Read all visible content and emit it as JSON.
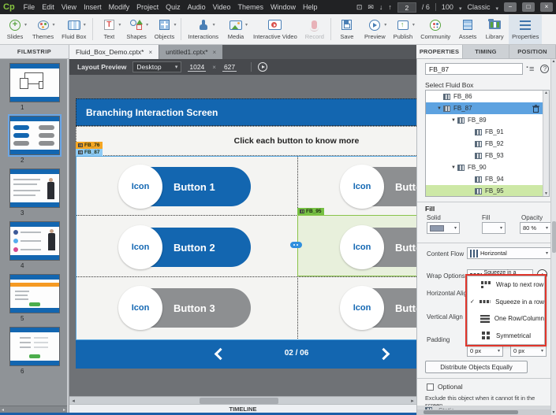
{
  "window": {
    "logo": "Cp",
    "menu_items": [
      "File",
      "Edit",
      "View",
      "Insert",
      "Modify",
      "Project",
      "Quiz",
      "Audio",
      "Video",
      "Themes",
      "Window",
      "Help"
    ],
    "slide_number": "2",
    "slide_total": "/  6",
    "zoom_level": "100",
    "workspace_selector": "Classic"
  },
  "toolbar": {
    "slides": "Slides",
    "themes": "Themes",
    "fluid_box": "Fluid Box",
    "text": "Text",
    "shapes": "Shapes",
    "objects": "Objects",
    "interactions": "Interactions",
    "media": "Media",
    "interactive_video": "Interactive Video",
    "record": "Record",
    "save": "Save",
    "preview": "Preview",
    "publish": "Publish",
    "community": "Community",
    "assets": "Assets",
    "library": "Library",
    "properties": "Properties"
  },
  "filmstrip": {
    "title": "FILMSTRIP",
    "slide_numbers": [
      "1",
      "2",
      "3",
      "4",
      "5",
      "6"
    ]
  },
  "tabs": {
    "tab1": "Fluid_Box_Demo.cptx*",
    "tab2": "untitled1.cptx*",
    "close": "×"
  },
  "layout_bar": {
    "label": "Layout Preview",
    "device": "Desktop",
    "width": "1024",
    "x": "×",
    "height": "627"
  },
  "canvas": {
    "title": "Branching Interaction Screen",
    "subtitle": "Click each button to know more",
    "fb76_tag": "FB_76",
    "fb87_tag": "FB_87",
    "fb95_tag": "FB_95",
    "icon_label": "Icon",
    "button1": "Button 1",
    "button2": "Button 2",
    "button3": "Button 3",
    "button_partial": "Button",
    "pager": "02 / 06"
  },
  "properties": {
    "tab_properties": "PROPERTIES",
    "tab_timing": "TIMING",
    "tab_position": "POSITION",
    "name_value": "FB_87",
    "select_label": "Select Fluid Box",
    "tree": [
      {
        "label": "FB_86"
      },
      {
        "label": "FB_87"
      },
      {
        "label": "FB_89"
      },
      {
        "label": "FB_91"
      },
      {
        "label": "FB_92"
      },
      {
        "label": "FB_93"
      },
      {
        "label": "FB_90"
      },
      {
        "label": "FB_94"
      },
      {
        "label": "FB_95"
      }
    ],
    "fill_header": "Fill",
    "solid_label": "Solid",
    "fill_label": "Fill",
    "opacity_label": "Opacity",
    "opacity_value": "80 %",
    "content_flow_label": "Content Flow",
    "content_flow_value": "Horizontal",
    "wrap_label": "Wrap Options",
    "wrap_value": "Squeeze in a row",
    "horizontal_align_label": "Horizontal Align",
    "vertical_align_label": "Vertical Align",
    "padding_label": "Padding",
    "padding_value1": "0 px",
    "padding_value2": "0 px",
    "distribute_button": "Distribute Objects Equally",
    "optional_label": "Optional",
    "exclude_text": "Exclude this object when it cannot fit in the screen",
    "static_partial": "Static"
  },
  "wrap_menu": {
    "items": [
      {
        "label": "Wrap to next row",
        "checked": false
      },
      {
        "label": "Squeeze in a row",
        "checked": true
      },
      {
        "label": "One Row/Column",
        "checked": false
      },
      {
        "label": "Symmetrical",
        "checked": false
      }
    ]
  },
  "timeline": {
    "label": "TIMELINE"
  },
  "colors": {
    "slide_blue": "#1366b0",
    "button_gray": "#8d8f91",
    "selection_green": "#8ac34a",
    "tag_orange": "#f5a623",
    "tag_blue": "#8ecbf5",
    "tag_green": "#76c043",
    "highlight_red": "#e0352b",
    "tree_selected_blue": "#5da2e0"
  }
}
